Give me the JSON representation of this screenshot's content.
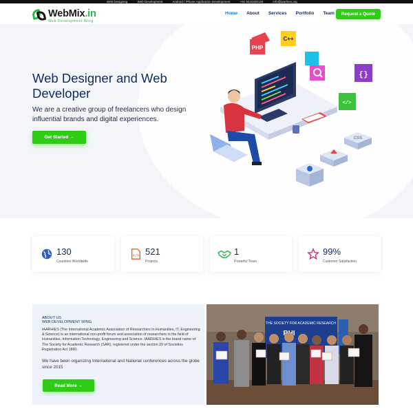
{
  "topbar": {
    "items": [
      "Web Designing",
      "Web Development",
      "Android / iPhone Application Development",
      "+91 9415329120",
      "info@iaarhies.org"
    ]
  },
  "brand": {
    "name_main": "WebMix",
    "name_suffix": ".in",
    "tagline": "Web Development Wing"
  },
  "nav": {
    "items": [
      "Home",
      "About",
      "Services",
      "Portfolio",
      "Team"
    ],
    "active": "Home",
    "cta": "Request a Quote"
  },
  "hero": {
    "title": "Web Designer and Web Developer",
    "subtitle": "We are a creative group of freelancers who design influential brands and digital experiences.",
    "button": "Get Started →",
    "illustration_labels": {
      "php": "PHP",
      "cpp": "C++",
      "css": "CSS"
    }
  },
  "stats": [
    {
      "value": "130",
      "label": "Countries Worldwide",
      "icon": "globe-icon"
    },
    {
      "value": "521",
      "label": "Projects",
      "icon": "code-file-icon"
    },
    {
      "value": "1",
      "label": "Powerful Team",
      "icon": "handshake-icon"
    },
    {
      "value": "99%",
      "label": "Customer Satisfaction",
      "icon": "star-icon"
    }
  ],
  "about": {
    "kicker1": "ABOUT US",
    "kicker2": "WEB DEVELOPMENT WING",
    "paragraph1": "IAARHIES (The International Academic Association of Researchers in Humanities, IT, Engineering & Science) is an international non-profit forum and association of researchers in the field of Humanities, Information Technology, Engineering and Science. IAARHIES is the brand name of The Society for Academic Research (SAR), registered under the section 20 of Societies Registration Act 1860.",
    "paragraph2": "We have been organizing International and National conferences across the globe since 2015",
    "button": "Read More →",
    "banner_text": "THE SOCIETY FOR ACADEMIC RESEARCH"
  },
  "colors": {
    "accent_green": "#2ecc14",
    "navy": "#0c2b5e",
    "link_blue": "#1f77c4"
  }
}
